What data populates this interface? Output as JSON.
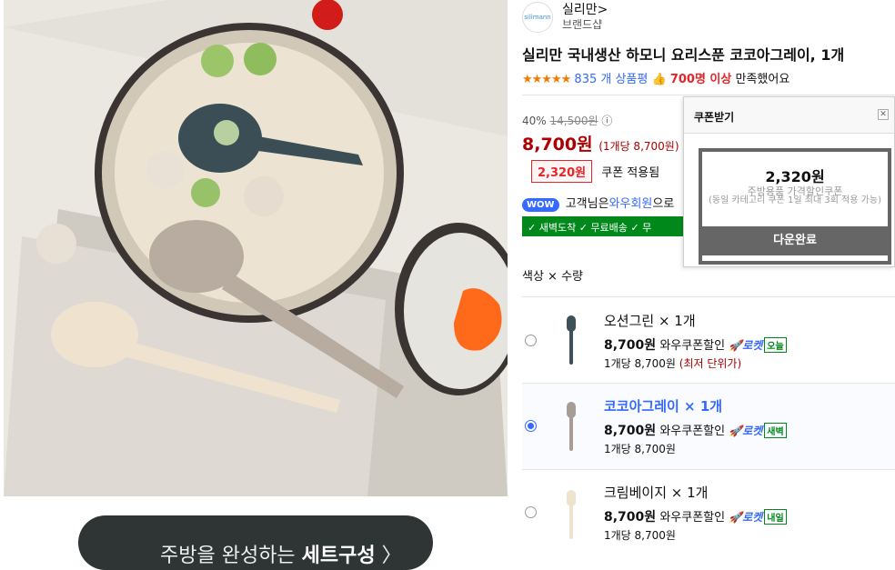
{
  "brand": {
    "logo_text": "silimann",
    "name": "실리만",
    "shop": "브랜드샵",
    "chevron": ">"
  },
  "product": {
    "title": "실리만 국내생산 하모니 요리스푼 코코아그레이, 1개"
  },
  "rating": {
    "stars": "★★★★★",
    "reviews": "835 개 상품평",
    "satisfied_count": "700명 이상",
    "satisfied_text": "만족했어요"
  },
  "pricing": {
    "discount": "40%",
    "original": "14,500원",
    "price": "8,700원",
    "unit_price": "(1개당 8,700원)",
    "coupon_amount": "2,320원",
    "coupon_label": "쿠폰 적용됨"
  },
  "wow": {
    "badge": "WOW",
    "prefix": "고객님은",
    "link": "와우회원",
    "suffix": "으로"
  },
  "benefits": {
    "text": "✓ 새벽도착 ✓ 무료배송 ✓ 무"
  },
  "options": {
    "section_title": "색상 × 수량",
    "items": [
      {
        "name": "오션그린 × 1개",
        "price": "8,700원",
        "coupon": "와우쿠폰할인",
        "rocket": "🚀로켓",
        "delivery": "오늘",
        "unit": "1개당 8,700원",
        "note": "(최저 단위가)",
        "color": "#3e5058"
      },
      {
        "name": "코코아그레이 × 1개",
        "price": "8,700원",
        "coupon": "와우쿠폰할인",
        "rocket": "🚀로켓",
        "delivery": "새벽",
        "unit": "1개당 8,700원",
        "note": "",
        "color": "#a89d95"
      },
      {
        "name": "크림베이지 × 1개",
        "price": "8,700원",
        "coupon": "와우쿠폰할인",
        "rocket": "🚀로켓",
        "delivery": "내일",
        "unit": "1개당 8,700원",
        "note": "",
        "color": "#efe3cf"
      }
    ]
  },
  "coupon_popup": {
    "title": "쿠폰받기",
    "amount": "2,320원",
    "desc1": "주방용품 가격할인쿠폰",
    "desc2": "(동일 카테고리 쿠폰 1일 최대 3회 적용 가능)",
    "button": "다운완료"
  },
  "banner": {
    "text": "주방을 완성하는 ",
    "bold": "세트구성",
    "arrow": "〉"
  },
  "colors": {
    "accent_blue": "#346aff",
    "price_red": "#ae0000",
    "rocket_green": "#00891a"
  }
}
